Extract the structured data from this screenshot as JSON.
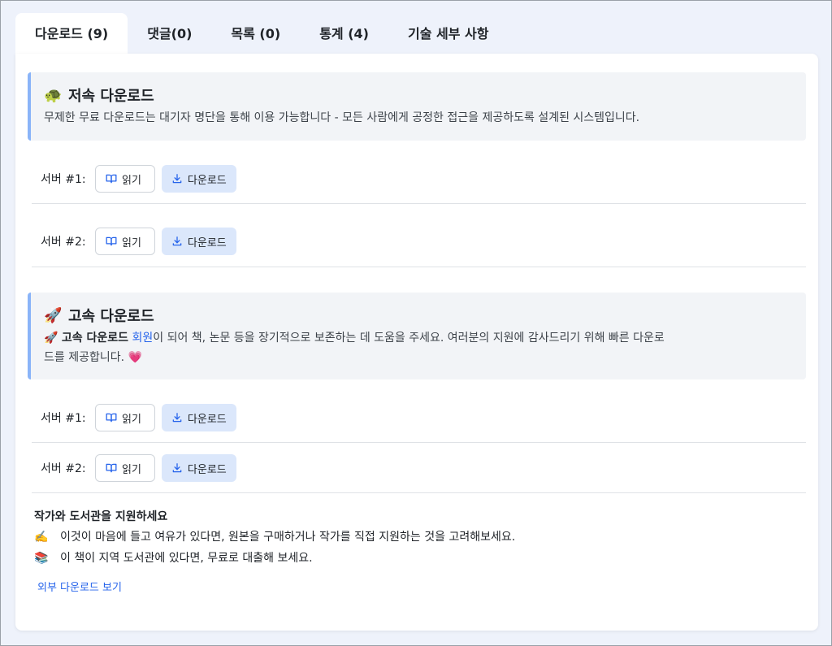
{
  "tabs": [
    {
      "label": "다운로드 (9)",
      "active": true
    },
    {
      "label": "댓글(0)"
    },
    {
      "label": "목록 (0)"
    },
    {
      "label": "통계 (4)"
    },
    {
      "label": "기술 세부 사항"
    }
  ],
  "slow": {
    "emoji": "🐢",
    "title": "저속 다운로드",
    "desc": "무제한 무료 다운로드는 대기자 명단을 통해 이용 가능합니다 - 모든 사람에게 공정한 접근을 제공하도록 설계된 시스템입니다.",
    "servers": [
      {
        "label": "서버 #1:",
        "read": "읽기",
        "download": "다운로드"
      },
      {
        "label": "서버 #2:",
        "read": "읽기",
        "download": "다운로드"
      }
    ]
  },
  "fast": {
    "emoji": "🚀",
    "title": "고속 다운로드",
    "desc_prefix_emoji": "🚀",
    "desc_bold": "고속 다운로드",
    "desc_link": "회원",
    "desc_rest_line1": "이 되어 책, 논문 등을 장기적으로 보존하는 데 도움을 주세요. 여러분의 지원에 감사드리기 위해 빠른 다운로",
    "desc_rest_line2": "드를 제공합니다.",
    "desc_heart": "💗",
    "servers": [
      {
        "label": "서버 #1:",
        "read": "읽기",
        "download": "다운로드"
      },
      {
        "label": "서버 #2:",
        "read": "읽기",
        "download": "다운로드"
      }
    ]
  },
  "support": {
    "title": "작가와 도서관을 지원하세요",
    "items": [
      {
        "emoji": "✍️",
        "text": "이것이 마음에 들고 여유가 있다면, 원본을 구매하거나 작가를 직접 지원하는 것을 고려해보세요."
      },
      {
        "emoji": "📚",
        "text": "이 책이 지역 도서관에 있다면, 무료로 대출해 보세요."
      }
    ],
    "external_link": "외부 다운로드 보기"
  },
  "icons": {
    "read": "book-open-icon",
    "download": "download-icon"
  },
  "colors": {
    "accent_border": "#8ab4f8",
    "download_bg": "#dbe7fb",
    "link": "#2563eb",
    "icon_blue": "#2563eb"
  }
}
